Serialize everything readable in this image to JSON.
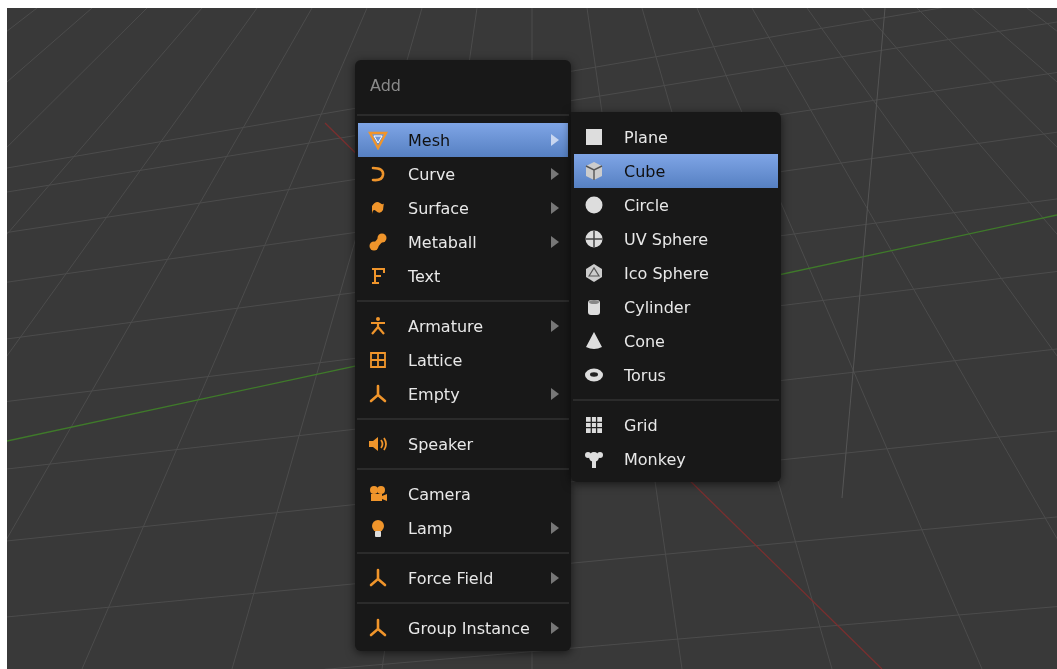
{
  "menu": {
    "title": "Add",
    "groups": [
      [
        {
          "label": "Mesh",
          "has_submenu": true,
          "selected": true
        },
        {
          "label": "Curve",
          "has_submenu": true,
          "selected": false
        },
        {
          "label": "Surface",
          "has_submenu": true,
          "selected": false
        },
        {
          "label": "Metaball",
          "has_submenu": true,
          "selected": false
        },
        {
          "label": "Text",
          "has_submenu": false,
          "selected": false
        }
      ],
      [
        {
          "label": "Armature",
          "has_submenu": true,
          "selected": false
        },
        {
          "label": "Lattice",
          "has_submenu": false,
          "selected": false
        },
        {
          "label": "Empty",
          "has_submenu": true,
          "selected": false
        }
      ],
      [
        {
          "label": "Speaker",
          "has_submenu": false,
          "selected": false
        }
      ],
      [
        {
          "label": "Camera",
          "has_submenu": false,
          "selected": false
        },
        {
          "label": "Lamp",
          "has_submenu": true,
          "selected": false
        }
      ],
      [
        {
          "label": "Force Field",
          "has_submenu": true,
          "selected": false
        }
      ],
      [
        {
          "label": "Group Instance",
          "has_submenu": true,
          "selected": false
        }
      ]
    ]
  },
  "submenu": {
    "groups": [
      [
        {
          "label": "Plane",
          "selected": false
        },
        {
          "label": "Cube",
          "selected": true
        },
        {
          "label": "Circle",
          "selected": false
        },
        {
          "label": "UV Sphere",
          "selected": false
        },
        {
          "label": "Ico Sphere",
          "selected": false
        },
        {
          "label": "Cylinder",
          "selected": false
        },
        {
          "label": "Cone",
          "selected": false
        },
        {
          "label": "Torus",
          "selected": false
        }
      ],
      [
        {
          "label": "Grid",
          "selected": false
        },
        {
          "label": "Monkey",
          "selected": false
        }
      ]
    ]
  }
}
